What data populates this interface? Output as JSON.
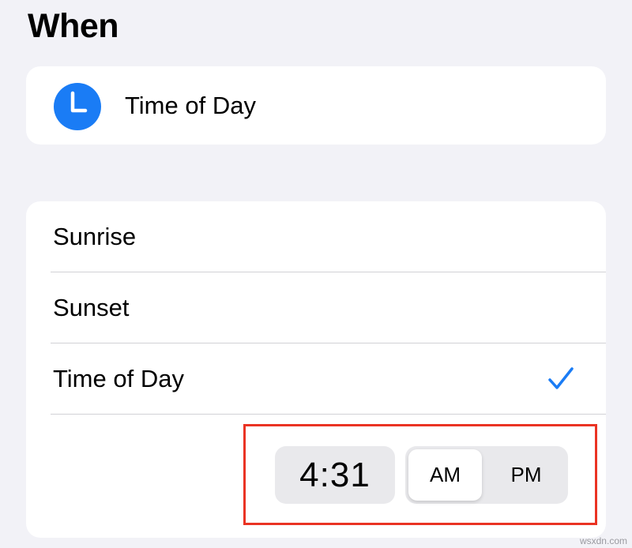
{
  "header": {
    "title": "When"
  },
  "trigger": {
    "icon": "clock-icon",
    "icon_color": "#1a7cf5",
    "label": "Time of Day"
  },
  "options": {
    "items": [
      {
        "label": "Sunrise",
        "selected": false
      },
      {
        "label": "Sunset",
        "selected": false
      },
      {
        "label": "Time of Day",
        "selected": true
      }
    ],
    "check_color": "#1a7cf5"
  },
  "time_picker": {
    "time": "4:31",
    "am_label": "AM",
    "pm_label": "PM",
    "selected_period": "AM",
    "highlight_color": "#ea3323"
  },
  "watermark": "wsxdn.com"
}
